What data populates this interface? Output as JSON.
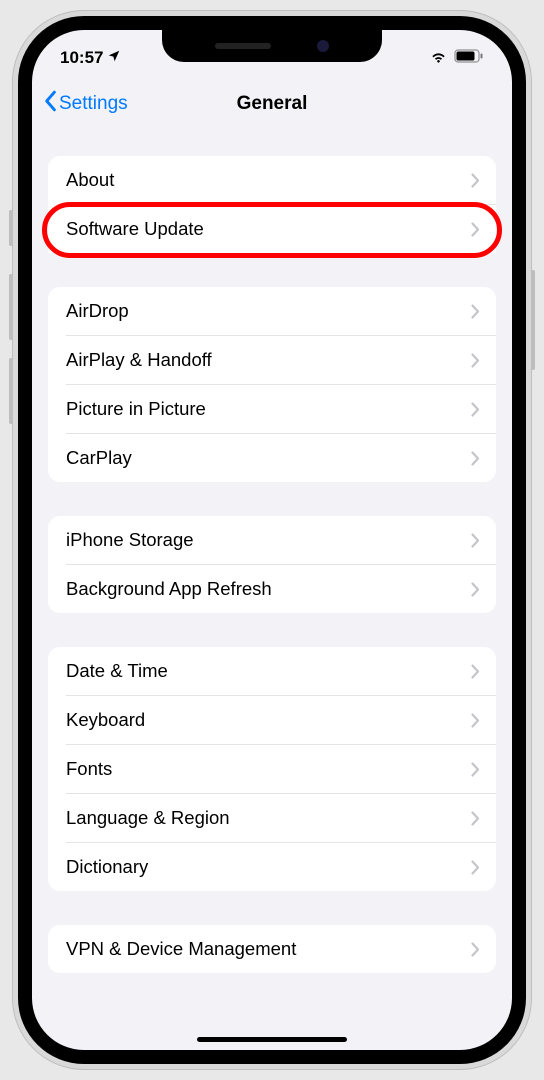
{
  "statusBar": {
    "time": "10:57"
  },
  "navBar": {
    "back": "Settings",
    "title": "General"
  },
  "groups": [
    {
      "rows": [
        {
          "label": "About",
          "highlighted": false
        },
        {
          "label": "Software Update",
          "highlighted": true
        }
      ]
    },
    {
      "rows": [
        {
          "label": "AirDrop"
        },
        {
          "label": "AirPlay & Handoff"
        },
        {
          "label": "Picture in Picture"
        },
        {
          "label": "CarPlay"
        }
      ]
    },
    {
      "rows": [
        {
          "label": "iPhone Storage"
        },
        {
          "label": "Background App Refresh"
        }
      ]
    },
    {
      "rows": [
        {
          "label": "Date & Time"
        },
        {
          "label": "Keyboard"
        },
        {
          "label": "Fonts"
        },
        {
          "label": "Language & Region"
        },
        {
          "label": "Dictionary"
        }
      ]
    },
    {
      "rows": [
        {
          "label": "VPN & Device Management"
        }
      ]
    }
  ]
}
